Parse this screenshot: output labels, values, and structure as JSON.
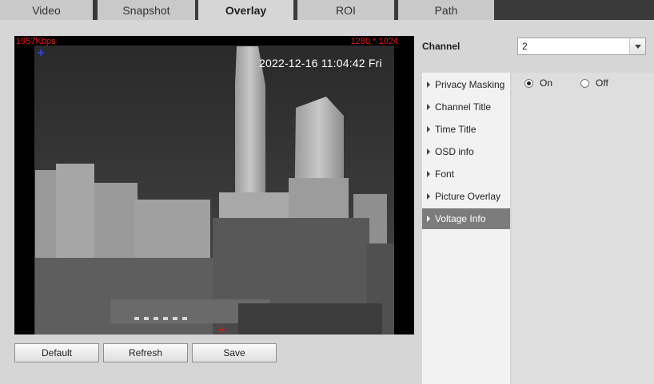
{
  "tabs": [
    {
      "label": "Video"
    },
    {
      "label": "Snapshot"
    },
    {
      "label": "Overlay"
    },
    {
      "label": "ROI"
    },
    {
      "label": "Path"
    }
  ],
  "active_tab": "Overlay",
  "preview": {
    "bitrate": "1957Kbps",
    "resolution": "1280 * 1024",
    "timestamp": "2022-12-16 11:04:42 Fri"
  },
  "buttons": {
    "default_label": "Default",
    "refresh_label": "Refresh",
    "save_label": "Save"
  },
  "channel": {
    "label": "Channel",
    "value": "2"
  },
  "menu": {
    "items": [
      {
        "label": "Privacy Masking"
      },
      {
        "label": "Channel Title"
      },
      {
        "label": "Time Title"
      },
      {
        "label": "OSD info"
      },
      {
        "label": "Font"
      },
      {
        "label": "Picture Overlay"
      },
      {
        "label": "Voltage Info"
      }
    ],
    "selected": "Voltage Info"
  },
  "voltage_info": {
    "on_label": "On",
    "off_label": "Off",
    "value": "On"
  },
  "colors": {
    "overlay_text": "#e11111",
    "selected_menu": "#7c7c7c",
    "tab_bar": "#3a3a3a"
  }
}
